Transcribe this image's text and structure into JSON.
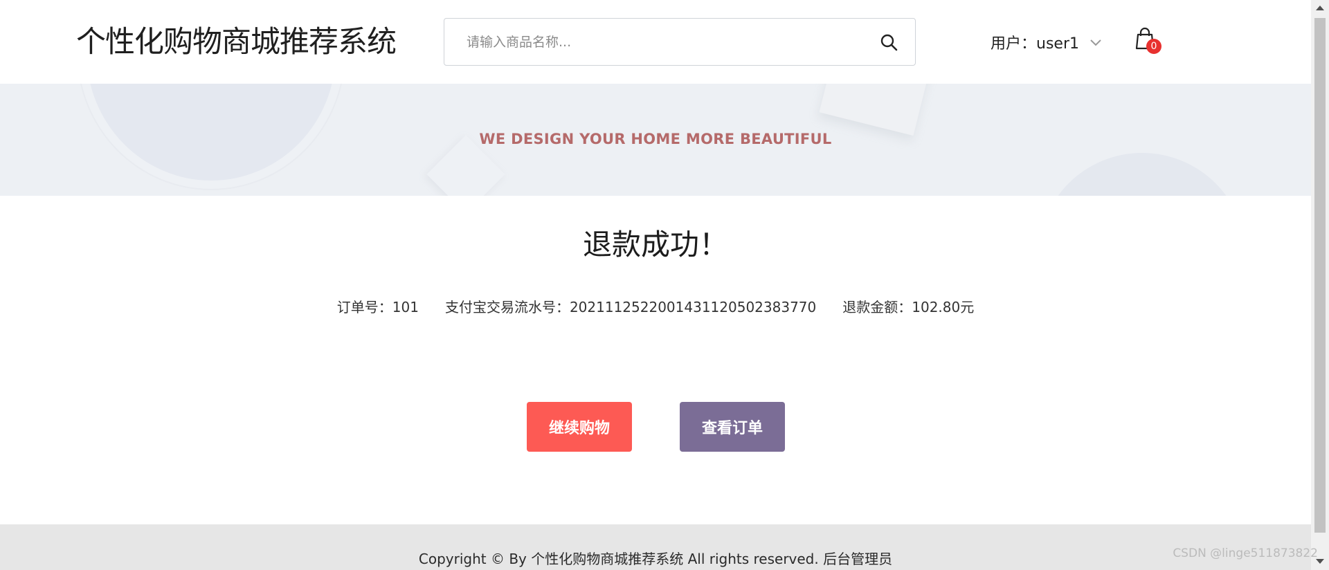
{
  "header": {
    "site_title": "个性化购物商城推荐系统",
    "search": {
      "placeholder": "请输入商品名称...",
      "value": ""
    },
    "user_menu_label": "用户：user1",
    "cart_count": "0"
  },
  "banner": {
    "tagline": "WE DESIGN YOUR HOME MORE BEAUTIFUL"
  },
  "main": {
    "title": "退款成功！",
    "order_no": "订单号：101",
    "alipay_trade_no": "支付宝交易流水号：2021112522001431120502383770",
    "refund_amount": "退款金额：102.80元",
    "continue_button": "继续购物",
    "orders_button": "查看订单"
  },
  "footer": {
    "copyright": "Copyright © By 个性化购物商城推荐系统 All rights reserved.",
    "admin_link": "后台管理员"
  },
  "watermark": "CSDN @linge511873822",
  "colors": {
    "banner_bg": "#edf0f4",
    "tagline": "#b56a6a",
    "continue_button": "#fd5a54",
    "orders_button": "#7b6d96",
    "badge": "#e8312f",
    "footer_bg": "#e6e6e6"
  },
  "icons": {
    "search": "search-icon",
    "dropdown": "chevron-down-icon",
    "cart": "shopping-bag-icon"
  }
}
